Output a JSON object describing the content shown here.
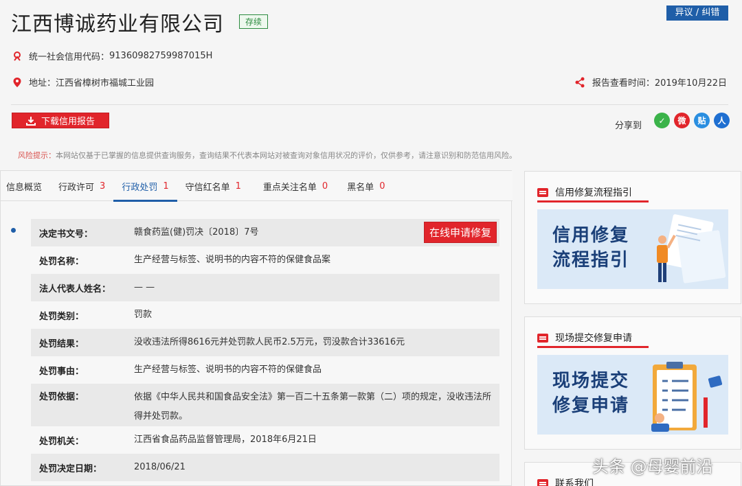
{
  "company": {
    "name": "江西博诚药业有限公司",
    "status": "存续",
    "objection_label": "异议 / 纠错",
    "credit_code_label": "统一社会信用代码：",
    "credit_code": "91360982759987015H",
    "address_label": "地址：",
    "address": "江西省樟树市福城工业园",
    "report_time_label": "报告查看时间：",
    "report_time": "2019年10月22日"
  },
  "actions": {
    "download_label": "下载信用报告",
    "share_label": "分享到",
    "share_icons": [
      "wechat-icon",
      "weibo-icon",
      "tieba-icon",
      "renren-icon"
    ],
    "share_glyphs": [
      "✓",
      "微",
      "贴",
      "人"
    ]
  },
  "risk": {
    "label": "风险提示：",
    "text": "本网站仅基于已掌握的信息提供查询服务，查询结果不代表本网站对被查询对象信用状况的评价，仅供参考，请注意识别和防范信用风险。"
  },
  "tabs": [
    {
      "label": "信息概览",
      "count": ""
    },
    {
      "label": "行政许可",
      "count": "3"
    },
    {
      "label": "行政处罚",
      "count": "1"
    },
    {
      "label": "守信红名单",
      "count": "1"
    },
    {
      "label": "重点关注名单",
      "count": "0"
    },
    {
      "label": "黑名单",
      "count": "0"
    }
  ],
  "detail": {
    "repair_button": "在线申请修复",
    "rows": [
      {
        "key": "决定书文号：",
        "value": "赣食药监(健)罚决〔2018〕7号"
      },
      {
        "key": "处罚名称：",
        "value": "生产经营与标签、说明书的内容不符的保健食品案"
      },
      {
        "key": "法人代表人姓名：",
        "value": "— —"
      },
      {
        "key": "处罚类别：",
        "value": "罚款"
      },
      {
        "key": "处罚结果：",
        "value": "没收违法所得8616元并处罚款人民币2.5万元，罚没款合计33616元"
      },
      {
        "key": "处罚事由：",
        "value": "生产经营与标签、说明书的内容不符的保健食品"
      },
      {
        "key": "处罚依据：",
        "value": "依据《中华人民共和国食品安全法》第一百二十五条第一款第（二）项的规定，没收违法所得并处罚款。"
      },
      {
        "key": "处罚机关：",
        "value": "江西省食品药品监督管理局，2018年6月21日"
      },
      {
        "key": "处罚决定日期：",
        "value": "2018/06/21"
      }
    ]
  },
  "sidebar": {
    "cards": [
      {
        "title": "信用修复流程指引",
        "banner_line1": "信用修复",
        "banner_line2": "流程指引"
      },
      {
        "title": "现场提交修复申请",
        "banner_line1": "现场提交",
        "banner_line2": "修复申请"
      },
      {
        "title": "联系我们"
      }
    ]
  },
  "watermark": "头条 @母婴前沿",
  "colors": {
    "accent_blue": "#1f5ea8",
    "accent_red": "#e1252b",
    "status_green": "#2b8a3e"
  }
}
